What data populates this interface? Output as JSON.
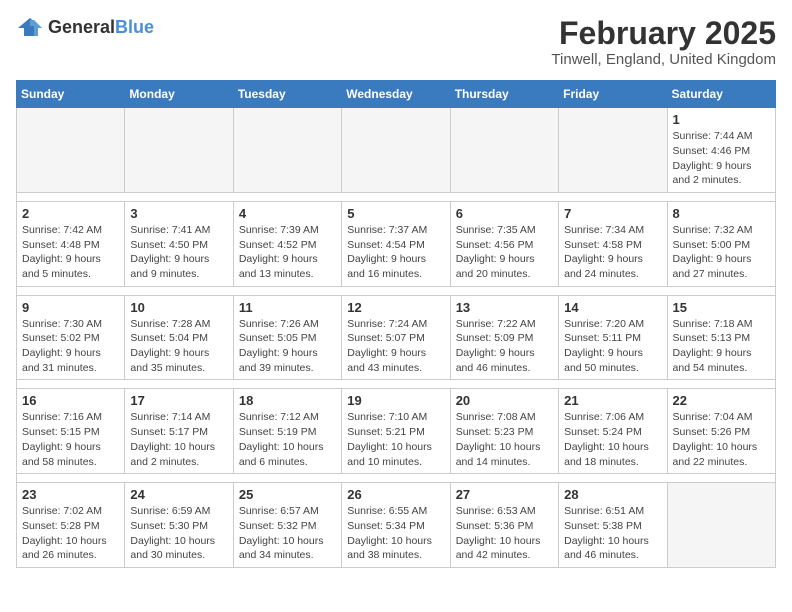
{
  "logo": {
    "general": "General",
    "blue": "Blue"
  },
  "title": "February 2025",
  "subtitle": "Tinwell, England, United Kingdom",
  "weekdays": [
    "Sunday",
    "Monday",
    "Tuesday",
    "Wednesday",
    "Thursday",
    "Friday",
    "Saturday"
  ],
  "weeks": [
    [
      {
        "day": "",
        "info": ""
      },
      {
        "day": "",
        "info": ""
      },
      {
        "day": "",
        "info": ""
      },
      {
        "day": "",
        "info": ""
      },
      {
        "day": "",
        "info": ""
      },
      {
        "day": "",
        "info": ""
      },
      {
        "day": "1",
        "info": "Sunrise: 7:44 AM\nSunset: 4:46 PM\nDaylight: 9 hours and 2 minutes."
      }
    ],
    [
      {
        "day": "2",
        "info": "Sunrise: 7:42 AM\nSunset: 4:48 PM\nDaylight: 9 hours and 5 minutes."
      },
      {
        "day": "3",
        "info": "Sunrise: 7:41 AM\nSunset: 4:50 PM\nDaylight: 9 hours and 9 minutes."
      },
      {
        "day": "4",
        "info": "Sunrise: 7:39 AM\nSunset: 4:52 PM\nDaylight: 9 hours and 13 minutes."
      },
      {
        "day": "5",
        "info": "Sunrise: 7:37 AM\nSunset: 4:54 PM\nDaylight: 9 hours and 16 minutes."
      },
      {
        "day": "6",
        "info": "Sunrise: 7:35 AM\nSunset: 4:56 PM\nDaylight: 9 hours and 20 minutes."
      },
      {
        "day": "7",
        "info": "Sunrise: 7:34 AM\nSunset: 4:58 PM\nDaylight: 9 hours and 24 minutes."
      },
      {
        "day": "8",
        "info": "Sunrise: 7:32 AM\nSunset: 5:00 PM\nDaylight: 9 hours and 27 minutes."
      }
    ],
    [
      {
        "day": "9",
        "info": "Sunrise: 7:30 AM\nSunset: 5:02 PM\nDaylight: 9 hours and 31 minutes."
      },
      {
        "day": "10",
        "info": "Sunrise: 7:28 AM\nSunset: 5:04 PM\nDaylight: 9 hours and 35 minutes."
      },
      {
        "day": "11",
        "info": "Sunrise: 7:26 AM\nSunset: 5:05 PM\nDaylight: 9 hours and 39 minutes."
      },
      {
        "day": "12",
        "info": "Sunrise: 7:24 AM\nSunset: 5:07 PM\nDaylight: 9 hours and 43 minutes."
      },
      {
        "day": "13",
        "info": "Sunrise: 7:22 AM\nSunset: 5:09 PM\nDaylight: 9 hours and 46 minutes."
      },
      {
        "day": "14",
        "info": "Sunrise: 7:20 AM\nSunset: 5:11 PM\nDaylight: 9 hours and 50 minutes."
      },
      {
        "day": "15",
        "info": "Sunrise: 7:18 AM\nSunset: 5:13 PM\nDaylight: 9 hours and 54 minutes."
      }
    ],
    [
      {
        "day": "16",
        "info": "Sunrise: 7:16 AM\nSunset: 5:15 PM\nDaylight: 9 hours and 58 minutes."
      },
      {
        "day": "17",
        "info": "Sunrise: 7:14 AM\nSunset: 5:17 PM\nDaylight: 10 hours and 2 minutes."
      },
      {
        "day": "18",
        "info": "Sunrise: 7:12 AM\nSunset: 5:19 PM\nDaylight: 10 hours and 6 minutes."
      },
      {
        "day": "19",
        "info": "Sunrise: 7:10 AM\nSunset: 5:21 PM\nDaylight: 10 hours and 10 minutes."
      },
      {
        "day": "20",
        "info": "Sunrise: 7:08 AM\nSunset: 5:23 PM\nDaylight: 10 hours and 14 minutes."
      },
      {
        "day": "21",
        "info": "Sunrise: 7:06 AM\nSunset: 5:24 PM\nDaylight: 10 hours and 18 minutes."
      },
      {
        "day": "22",
        "info": "Sunrise: 7:04 AM\nSunset: 5:26 PM\nDaylight: 10 hours and 22 minutes."
      }
    ],
    [
      {
        "day": "23",
        "info": "Sunrise: 7:02 AM\nSunset: 5:28 PM\nDaylight: 10 hours and 26 minutes."
      },
      {
        "day": "24",
        "info": "Sunrise: 6:59 AM\nSunset: 5:30 PM\nDaylight: 10 hours and 30 minutes."
      },
      {
        "day": "25",
        "info": "Sunrise: 6:57 AM\nSunset: 5:32 PM\nDaylight: 10 hours and 34 minutes."
      },
      {
        "day": "26",
        "info": "Sunrise: 6:55 AM\nSunset: 5:34 PM\nDaylight: 10 hours and 38 minutes."
      },
      {
        "day": "27",
        "info": "Sunrise: 6:53 AM\nSunset: 5:36 PM\nDaylight: 10 hours and 42 minutes."
      },
      {
        "day": "28",
        "info": "Sunrise: 6:51 AM\nSunset: 5:38 PM\nDaylight: 10 hours and 46 minutes."
      },
      {
        "day": "",
        "info": ""
      }
    ]
  ]
}
